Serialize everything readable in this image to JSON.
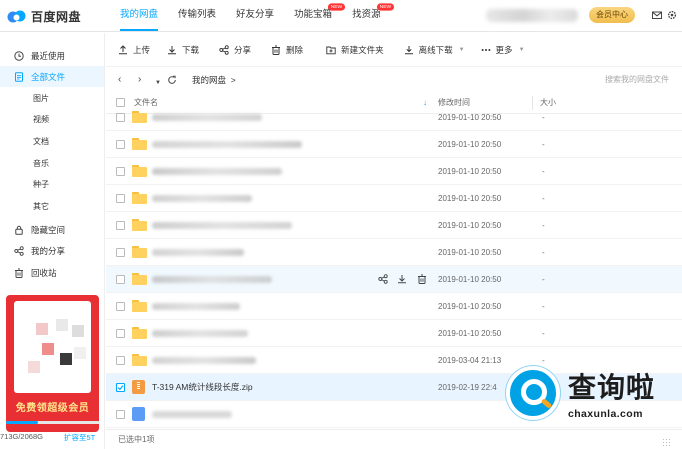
{
  "app": {
    "logo_text": "百度网盘"
  },
  "nav": {
    "items": [
      {
        "label": "我的网盘",
        "active": true
      },
      {
        "label": "传输列表"
      },
      {
        "label": "好友分享"
      },
      {
        "label": "功能宝箱",
        "badge": "NEW"
      },
      {
        "label": "找资源",
        "badge": "NEW"
      }
    ],
    "vip_label": "会员中心"
  },
  "sidebar": {
    "items": [
      {
        "label": "最近使用",
        "icon": "clock-icon"
      },
      {
        "label": "全部文件",
        "icon": "file-icon",
        "active": true
      },
      {
        "label": "隐藏空间",
        "icon": "lock-icon"
      },
      {
        "label": "我的分享",
        "icon": "share-icon"
      },
      {
        "label": "回收站",
        "icon": "trash-icon"
      }
    ],
    "subitems": [
      "图片",
      "视频",
      "文档",
      "音乐",
      "种子",
      "其它"
    ],
    "promo_text": "免费领超级会员",
    "quota": {
      "used_text": "713G/2068G",
      "fraction": 0.345,
      "link": "扩容至5T"
    }
  },
  "toolbar": {
    "items": [
      {
        "label": "上传",
        "icon": "upload-icon"
      },
      {
        "label": "下载",
        "icon": "download-icon"
      },
      {
        "label": "分享",
        "icon": "share-icon"
      },
      {
        "label": "删除",
        "icon": "trash-icon"
      },
      {
        "label": "新建文件夹",
        "icon": "new-folder-icon"
      },
      {
        "label": "离线下载",
        "icon": "offline-download-icon"
      },
      {
        "label": "更多",
        "icon": "more-icon"
      }
    ]
  },
  "pathbar": {
    "breadcrumb": "我的网盘",
    "separator": ">",
    "search_placeholder": "搜索我的网盘文件"
  },
  "table": {
    "headers": {
      "name": "文件名",
      "modified": "修改时间",
      "size": "大小"
    },
    "rows": [
      {
        "type": "folder",
        "date": "2019-01-10 20:50",
        "size": "-"
      },
      {
        "type": "folder",
        "date": "2019-01-10 20:50",
        "size": "-"
      },
      {
        "type": "folder",
        "date": "2019-01-10 20:50",
        "size": "-"
      },
      {
        "type": "folder",
        "date": "2019-01-10 20:50",
        "size": "-"
      },
      {
        "type": "folder",
        "date": "2019-01-10 20:50",
        "size": "-"
      },
      {
        "type": "folder",
        "date": "2019-01-10 20:50",
        "size": "-"
      },
      {
        "type": "folder",
        "date": "2019-01-10 20:50",
        "size": "-",
        "hover": true
      },
      {
        "type": "folder",
        "date": "2019-01-10 20:50",
        "size": "-"
      },
      {
        "type": "folder",
        "date": "2019-01-10 20:50",
        "size": "-"
      },
      {
        "type": "folder",
        "date": "2019-03-04 21:13",
        "size": "-"
      },
      {
        "type": "zip",
        "name": "T-319 AM统计线段长度.zip",
        "date": "2019-02-19 22:4",
        "size": "",
        "selected": true
      },
      {
        "type": "image",
        "date": "",
        "size": ""
      }
    ]
  },
  "status": {
    "selected_text": "已选中1项"
  },
  "watermark": {
    "title": "查询啦",
    "url": "chaxunla.com"
  },
  "colors": {
    "accent": "#06a7ff",
    "folder": "#ffd15e",
    "vip": "#f1bd4d",
    "promo": "#e72f34"
  }
}
